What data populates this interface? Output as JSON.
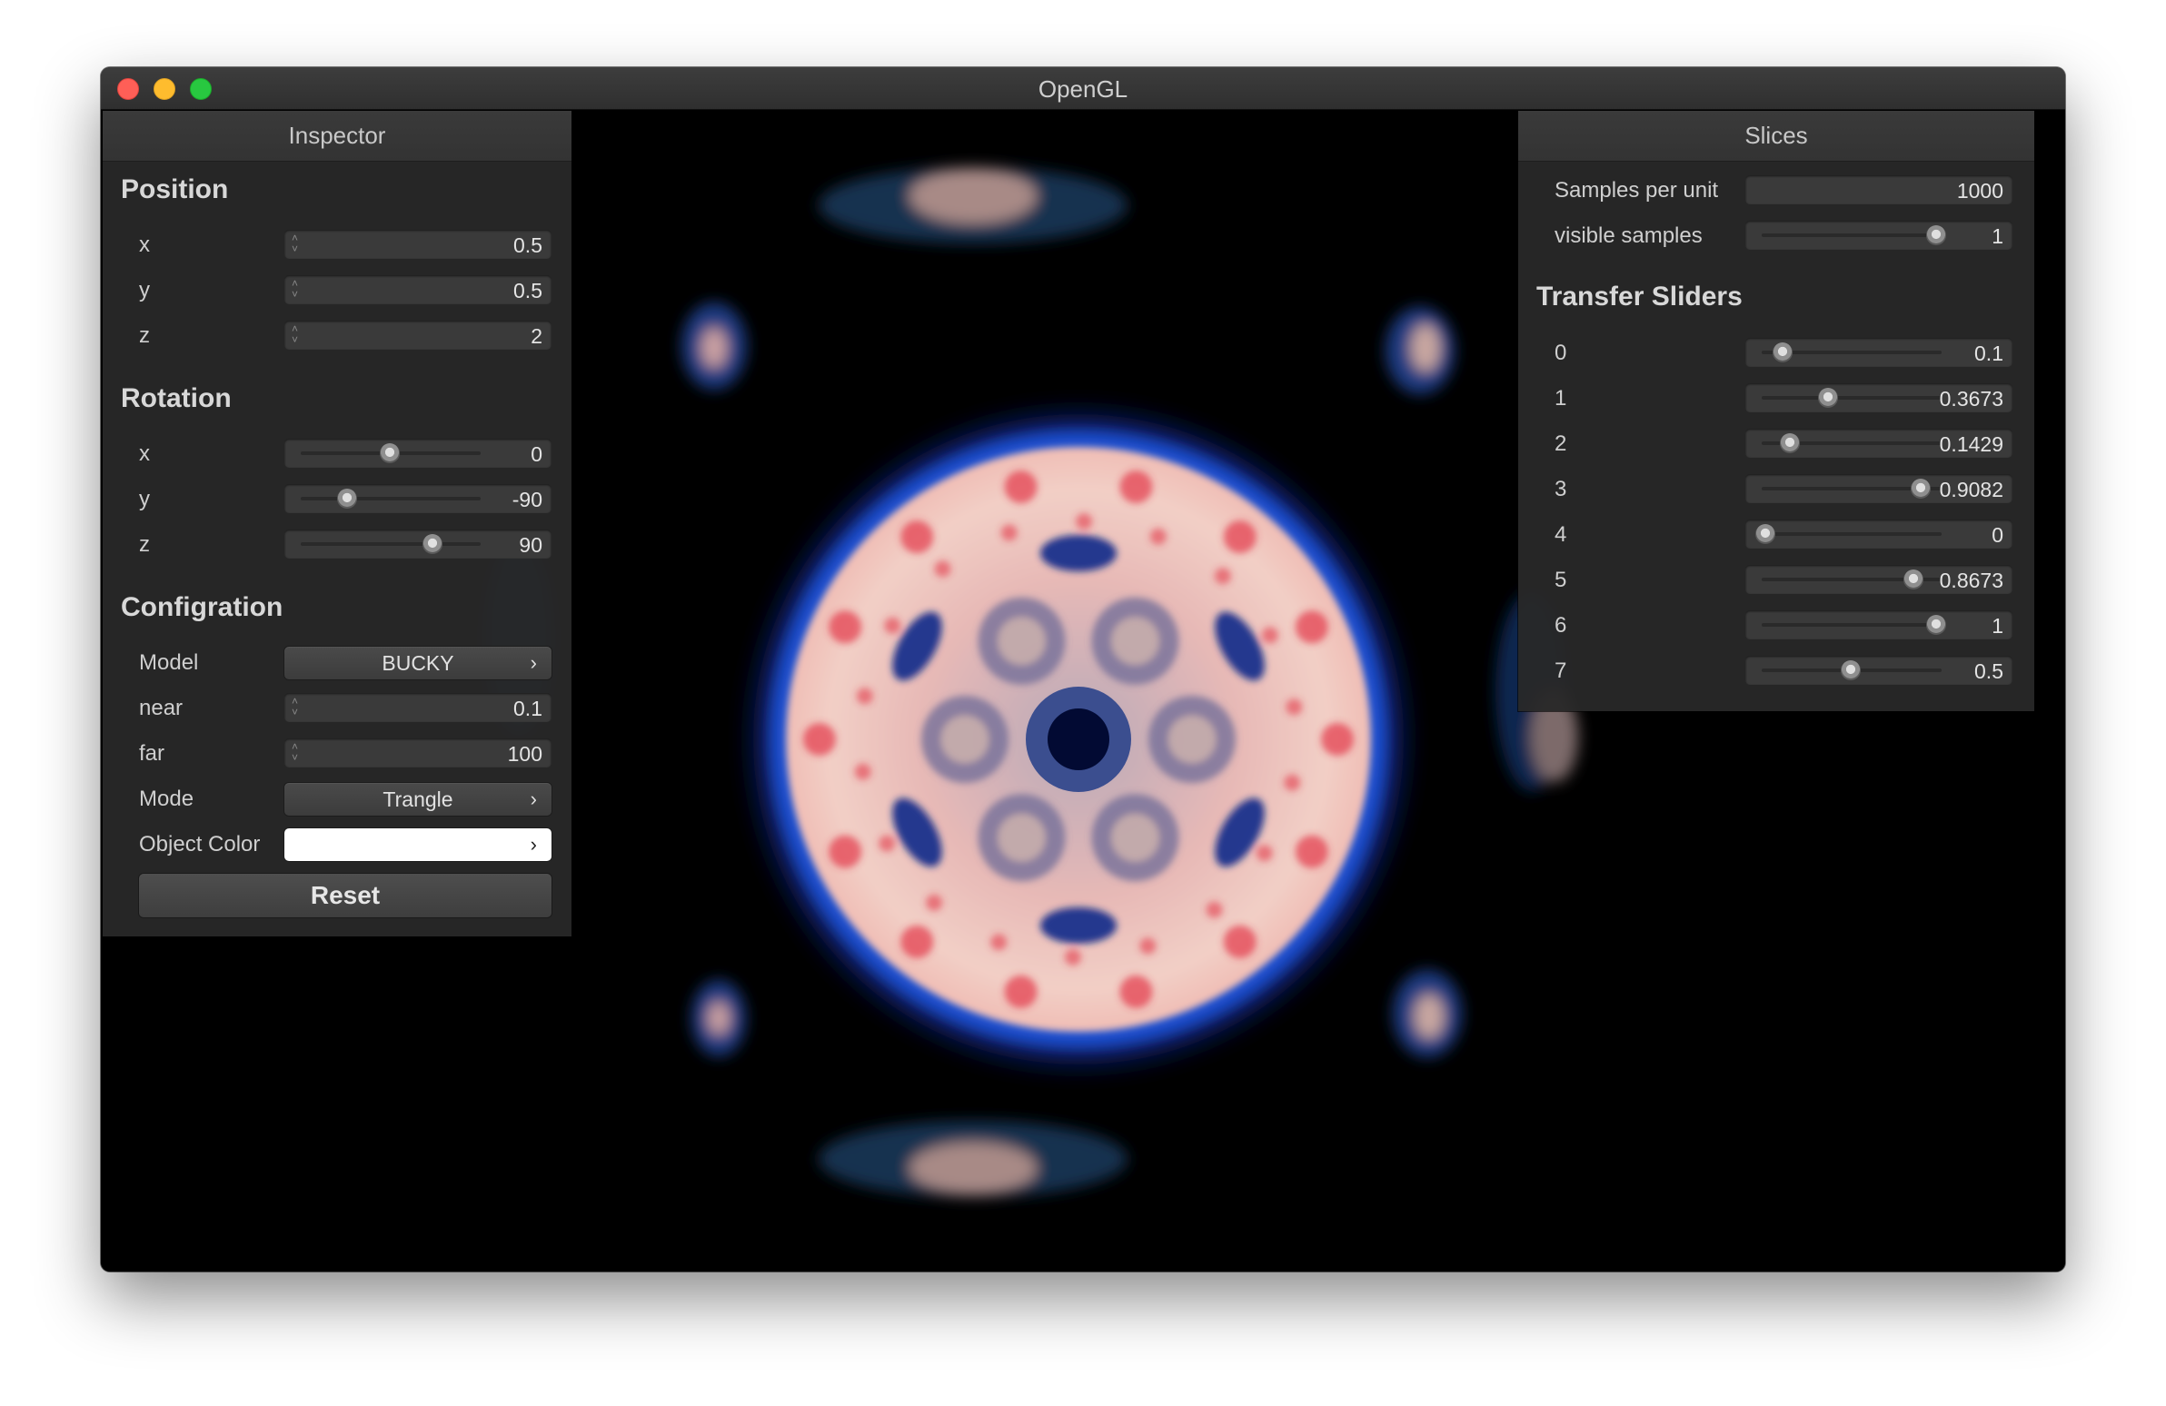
{
  "window": {
    "title": "OpenGL"
  },
  "inspector": {
    "header": "Inspector",
    "position": {
      "title": "Position",
      "fields": [
        {
          "label": "x",
          "value": "0.5"
        },
        {
          "label": "y",
          "value": "0.5"
        },
        {
          "label": "z",
          "value": "2"
        }
      ]
    },
    "rotation": {
      "title": "Rotation",
      "sliders": [
        {
          "label": "x",
          "value": "0",
          "level": 0.5
        },
        {
          "label": "y",
          "value": "-90",
          "level": 0.25
        },
        {
          "label": "z",
          "value": "90",
          "level": 0.75
        }
      ]
    },
    "configuration": {
      "title": "Configration",
      "model_label": "Model",
      "model_value": "BUCKY",
      "near_label": "near",
      "near_value": "0.1",
      "far_label": "far",
      "far_value": "100",
      "mode_label": "Mode",
      "mode_value": "Trangle",
      "object_color_label": "Object Color",
      "object_color": "#ffffff"
    },
    "reset_label": "Reset"
  },
  "slices": {
    "header": "Slices",
    "samples_per_unit_label": "Samples per unit",
    "samples_per_unit_value": "1000",
    "visible_samples_label": "visible samples",
    "visible_samples_value": "1",
    "visible_samples_level": 1.0,
    "transfer_title": "Transfer Sliders",
    "transfer": [
      {
        "label": "0",
        "value": "0.1",
        "level": 0.1
      },
      {
        "label": "1",
        "value": "0.3673",
        "level": 0.3673
      },
      {
        "label": "2",
        "value": "0.1429",
        "level": 0.1429
      },
      {
        "label": "3",
        "value": "0.9082",
        "level": 0.9082
      },
      {
        "label": "4",
        "value": "0",
        "level": 0.0
      },
      {
        "label": "5",
        "value": "0.8673",
        "level": 0.8673
      },
      {
        "label": "6",
        "value": "1",
        "level": 1.0
      },
      {
        "label": "7",
        "value": "0.5",
        "level": 0.5
      }
    ]
  },
  "colors": {
    "volume_shell": "#f2c3bc",
    "volume_rim": "#1d4fd0",
    "volume_hotspot": "#e2364a",
    "volume_hole": "#0a2a8a"
  }
}
